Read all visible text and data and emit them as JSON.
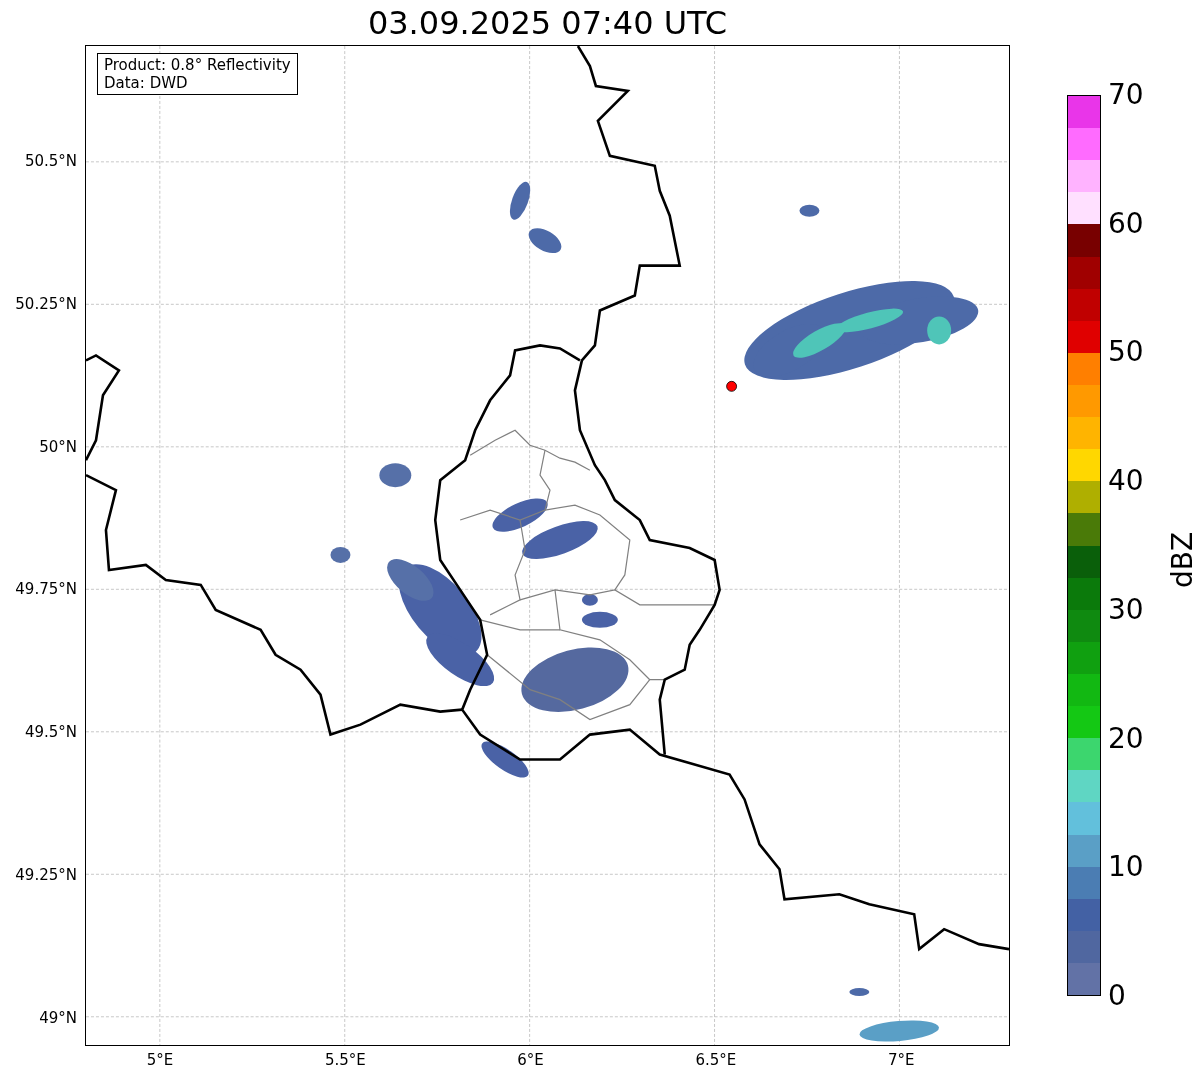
{
  "title": "03.09.2025 07:40 UTC",
  "annotation": {
    "lines": [
      "Product: 0.8° Reflectivity",
      "Data: DWD"
    ]
  },
  "map": {
    "y_ticks": [
      "50.5°N",
      "50.25°N",
      "50°N",
      "49.75°N",
      "49.5°N",
      "49.25°N",
      "49°N"
    ],
    "x_ticks": [
      "5°E",
      "5.5°E",
      "6°E",
      "6.5°E",
      "7°E"
    ]
  },
  "colorbar": {
    "label": "dBZ",
    "ticks": [
      "70",
      "60",
      "50",
      "40",
      "30",
      "20",
      "10",
      "0"
    ],
    "bins": [
      {
        "color": "#e935e9"
      },
      {
        "color": "#ff6bff"
      },
      {
        "color": "#ffb3ff"
      },
      {
        "color": "#ffe0ff"
      },
      {
        "color": "#780000"
      },
      {
        "color": "#a00000"
      },
      {
        "color": "#c00000"
      },
      {
        "color": "#e00000"
      },
      {
        "color": "#ff7f00"
      },
      {
        "color": "#ff9900"
      },
      {
        "color": "#ffb400"
      },
      {
        "color": "#ffd700"
      },
      {
        "color": "#afaf00"
      },
      {
        "color": "#4a7a08"
      },
      {
        "color": "#0a5f0a"
      },
      {
        "color": "#0b7a0b"
      },
      {
        "color": "#0f8a10"
      },
      {
        "color": "#10a010"
      },
      {
        "color": "#12b812"
      },
      {
        "color": "#14c814"
      },
      {
        "color": "#3cd66e"
      },
      {
        "color": "#5fd6c3"
      },
      {
        "color": "#62c0dc"
      },
      {
        "color": "#5a9fc6"
      },
      {
        "color": "#4b7db3"
      },
      {
        "color": "#4361a4"
      },
      {
        "color": "#5067a0"
      },
      {
        "color": "#6272a6"
      }
    ]
  }
}
